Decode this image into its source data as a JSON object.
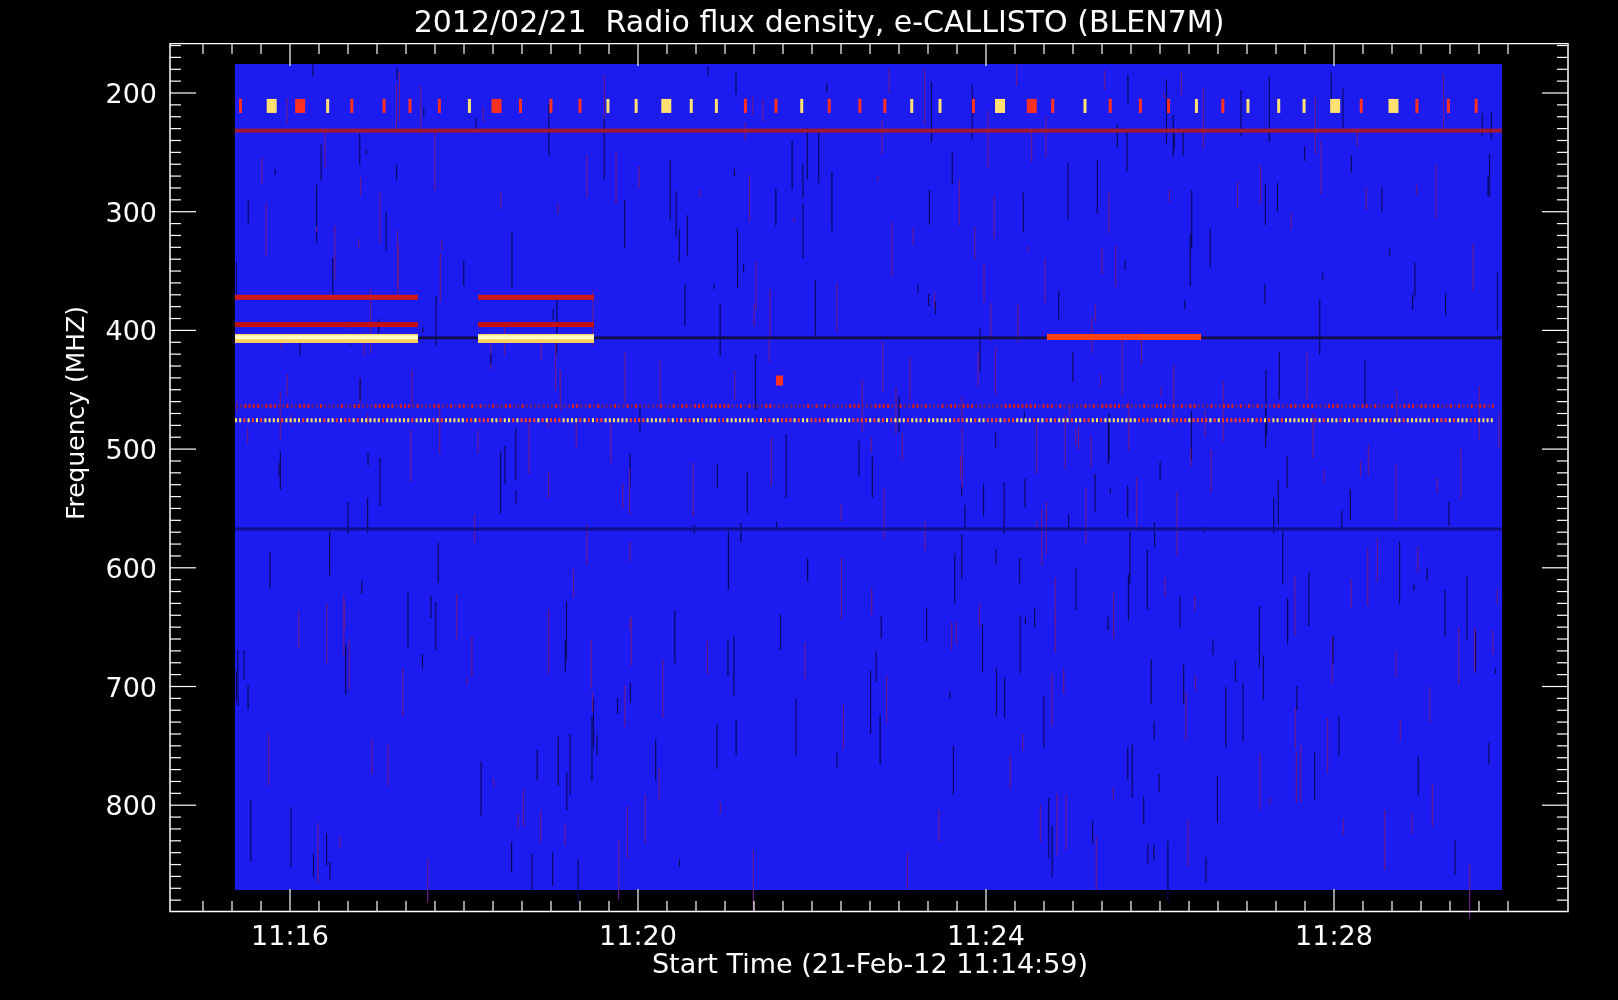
{
  "title": "2012/02/21  Radio flux density, e-CALLISTO (BLEN7M)",
  "plot": {
    "ylabel": "Frequency (MHZ)",
    "xlabel": "Start Time (21-Feb-12 11:14:59)",
    "yticks": [
      "200",
      "300",
      "400",
      "500",
      "600",
      "700",
      "800"
    ],
    "xticks": [
      "11:16",
      "11:20",
      "11:24",
      "11:28"
    ]
  }
}
